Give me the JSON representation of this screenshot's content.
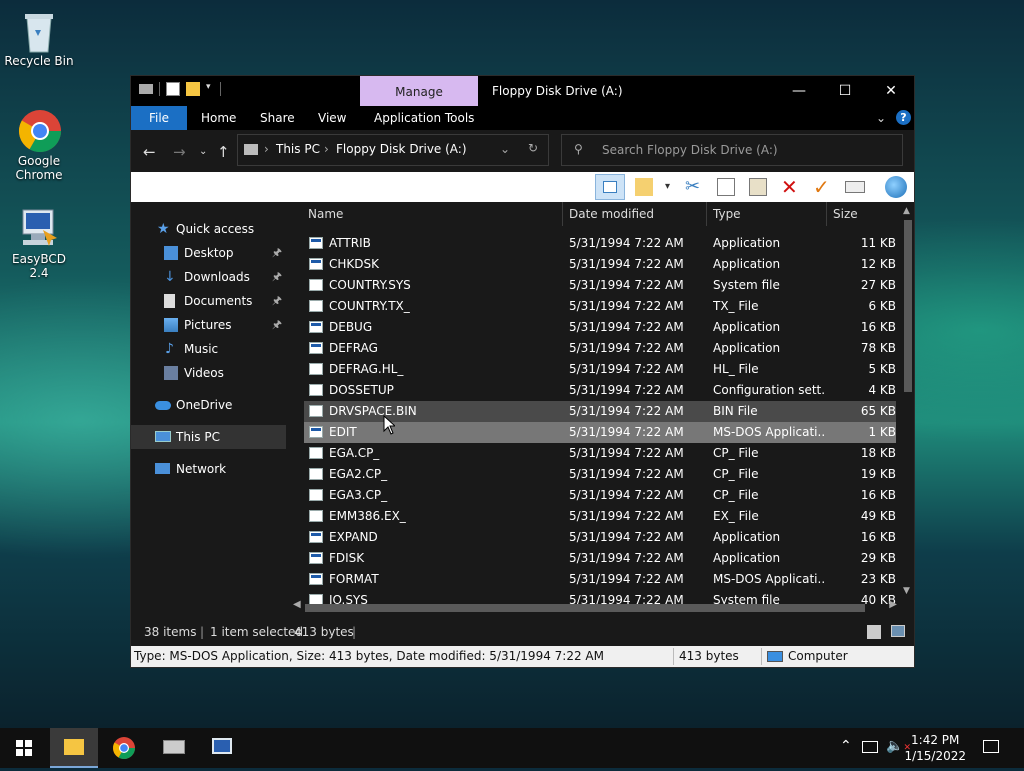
{
  "desktop": {
    "icons": [
      {
        "label": "Recycle Bin"
      },
      {
        "label": "Google Chrome"
      },
      {
        "label": "EasyBCD 2.4"
      }
    ]
  },
  "window": {
    "manage_tab": "Manage",
    "title": "Floppy Disk Drive (A:)",
    "ribbon_tabs": [
      "File",
      "Home",
      "Share",
      "View",
      "Application Tools"
    ],
    "breadcrumb": [
      "This PC",
      "Floppy Disk Drive (A:)"
    ],
    "search_placeholder": "Search Floppy Disk Drive (A:)"
  },
  "nav": {
    "items": [
      {
        "label": "Quick access"
      },
      {
        "label": "Desktop"
      },
      {
        "label": "Downloads"
      },
      {
        "label": "Documents"
      },
      {
        "label": "Pictures"
      },
      {
        "label": "Music"
      },
      {
        "label": "Videos"
      },
      {
        "label": "OneDrive"
      },
      {
        "label": "This PC"
      },
      {
        "label": "Network"
      }
    ]
  },
  "columns": {
    "name": "Name",
    "date": "Date modified",
    "type": "Type",
    "size": "Size"
  },
  "files": [
    {
      "name": "ATTRIB",
      "date": "5/31/1994 7:22 AM",
      "type": "Application",
      "size": "11 KB"
    },
    {
      "name": "CHKDSK",
      "date": "5/31/1994 7:22 AM",
      "type": "Application",
      "size": "12 KB"
    },
    {
      "name": "COUNTRY.SYS",
      "date": "5/31/1994 7:22 AM",
      "type": "System file",
      "size": "27 KB"
    },
    {
      "name": "COUNTRY.TX_",
      "date": "5/31/1994 7:22 AM",
      "type": "TX_ File",
      "size": "6 KB"
    },
    {
      "name": "DEBUG",
      "date": "5/31/1994 7:22 AM",
      "type": "Application",
      "size": "16 KB"
    },
    {
      "name": "DEFRAG",
      "date": "5/31/1994 7:22 AM",
      "type": "Application",
      "size": "78 KB"
    },
    {
      "name": "DEFRAG.HL_",
      "date": "5/31/1994 7:22 AM",
      "type": "HL_ File",
      "size": "5 KB"
    },
    {
      "name": "DOSSETUP",
      "date": "5/31/1994 7:22 AM",
      "type": "Configuration sett...",
      "size": "4 KB"
    },
    {
      "name": "DRVSPACE.BIN",
      "date": "5/31/1994 7:22 AM",
      "type": "BIN File",
      "size": "65 KB"
    },
    {
      "name": "EDIT",
      "date": "5/31/1994 7:22 AM",
      "type": "MS-DOS Applicati...",
      "size": "1 KB"
    },
    {
      "name": "EGA.CP_",
      "date": "5/31/1994 7:22 AM",
      "type": "CP_ File",
      "size": "18 KB"
    },
    {
      "name": "EGA2.CP_",
      "date": "5/31/1994 7:22 AM",
      "type": "CP_ File",
      "size": "19 KB"
    },
    {
      "name": "EGA3.CP_",
      "date": "5/31/1994 7:22 AM",
      "type": "CP_ File",
      "size": "16 KB"
    },
    {
      "name": "EMM386.EX_",
      "date": "5/31/1994 7:22 AM",
      "type": "EX_ File",
      "size": "49 KB"
    },
    {
      "name": "EXPAND",
      "date": "5/31/1994 7:22 AM",
      "type": "Application",
      "size": "16 KB"
    },
    {
      "name": "FDISK",
      "date": "5/31/1994 7:22 AM",
      "type": "Application",
      "size": "29 KB"
    },
    {
      "name": "FORMAT",
      "date": "5/31/1994 7:22 AM",
      "type": "MS-DOS Applicati...",
      "size": "23 KB"
    },
    {
      "name": "IO.SYS",
      "date": "5/31/1994 7:22 AM",
      "type": "System file",
      "size": "40 KB"
    }
  ],
  "status": {
    "items": "38 items",
    "selected": "1 item selected",
    "bytes": "413 bytes"
  },
  "details": {
    "text": "Type: MS-DOS Application, Size: 413 bytes, Date modified: 5/31/1994 7:22 AM",
    "size": "413 bytes",
    "location": "Computer"
  },
  "taskbar": {
    "time": "1:42 PM",
    "date": "1/15/2022"
  },
  "colors": {
    "accent": "#1b6fc4",
    "manage": "#d7b9f0",
    "selected_row": "#777777",
    "hover_row": "#4a4a4a"
  }
}
